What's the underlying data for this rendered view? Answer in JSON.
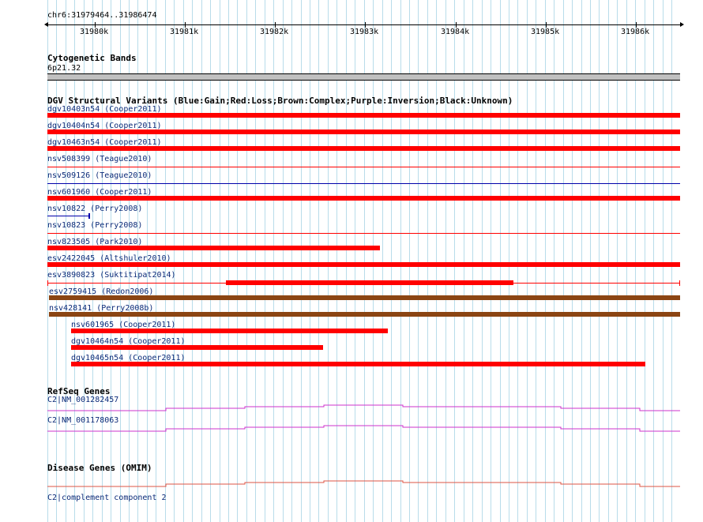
{
  "ruler": {
    "position": "chr6:31979464..31986474",
    "ticks": [
      "31980k",
      "31981k",
      "31982k",
      "31983k",
      "31984k",
      "31985k",
      "31986k"
    ]
  },
  "cyto": {
    "title": "Cytogenetic Bands",
    "band": "6p21.32"
  },
  "dgv": {
    "title": "DGV Structural Variants (Blue:Gain;Red:Loss;Brown:Complex;Purple:Inversion;Black:Unknown)",
    "items": [
      {
        "label": "dgv10403n54 (Cooper2011)",
        "color": "#ff0000",
        "style": "thick"
      },
      {
        "label": "dgv10404n54 (Cooper2011)",
        "color": "#ff0000",
        "style": "thick"
      },
      {
        "label": "dgv10463n54 (Cooper2011)",
        "color": "#ff0000",
        "style": "thick"
      },
      {
        "label": "nsv508399 (Teague2010)",
        "color": "#ff0000",
        "style": "thin"
      },
      {
        "label": "nsv509126 (Teague2010)",
        "color": "#0000aa",
        "style": "thin"
      },
      {
        "label": "nsv601960 (Cooper2011)",
        "color": "#ff0000",
        "style": "thick"
      },
      {
        "label": "nsv10822 (Perry2008)",
        "color": "#0000aa",
        "style": "tiny"
      },
      {
        "label": "nsv10823 (Perry2008)",
        "color": "#ff0000",
        "style": "thin"
      },
      {
        "label": "nsv823505 (Park2010)",
        "color": "#ff0000",
        "style": "thick"
      },
      {
        "label": "esv2422045 (Altshuler2010)",
        "color": "#ff0000",
        "style": "thick"
      },
      {
        "label": "esv3890823 (Suktitipat2014)",
        "color": "#ff0000",
        "style": "mixed"
      },
      {
        "label": "esv2759415 (Redon2006)",
        "color": "#8b4513",
        "style": "thick"
      },
      {
        "label": "nsv428141 (Perry2008b)",
        "color": "#8b4513",
        "style": "thick"
      },
      {
        "label": "nsv601965 (Cooper2011)",
        "color": "#ff0000",
        "style": "thick"
      },
      {
        "label": "dgv10464n54 (Cooper2011)",
        "color": "#ff0000",
        "style": "thick"
      },
      {
        "label": "dgv10465n54 (Cooper2011)",
        "color": "#ff0000",
        "style": "thick"
      }
    ]
  },
  "refseq": {
    "title": "RefSeq Genes",
    "items": [
      {
        "label": "C2|NM_001282457",
        "color": "#cc33cc"
      },
      {
        "label": "C2|NM_001178063",
        "color": "#cc33cc"
      }
    ]
  },
  "omim": {
    "title": "Disease Genes (OMIM)",
    "items": [
      {
        "label": "C2|complement component 2",
        "color": "#dd5544"
      }
    ]
  }
}
